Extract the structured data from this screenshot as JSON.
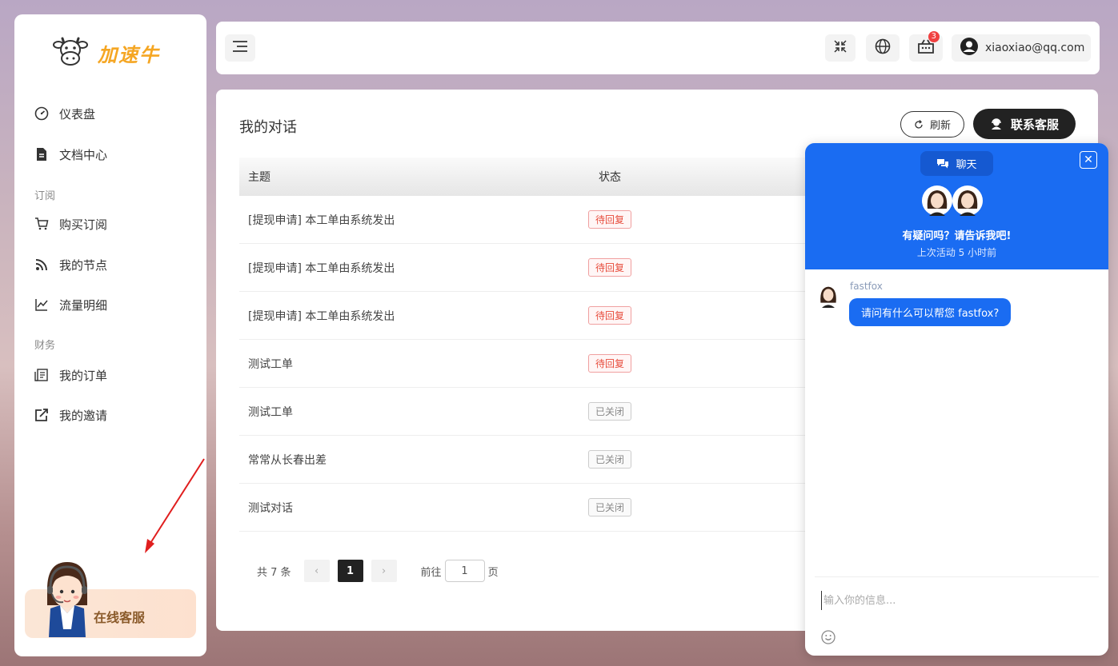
{
  "brand": {
    "name": "加速牛"
  },
  "sidebar": {
    "items": [
      {
        "label": "仪表盘",
        "icon": "dashboard-icon"
      },
      {
        "label": "文档中心",
        "icon": "document-icon"
      },
      {
        "label": "购买订阅",
        "icon": "cart-icon"
      },
      {
        "label": "我的节点",
        "icon": "rss-icon"
      },
      {
        "label": "流量明细",
        "icon": "chart-line-icon"
      },
      {
        "label": "我的订单",
        "icon": "order-icon"
      },
      {
        "label": "我的邀请",
        "icon": "share-icon"
      }
    ],
    "groups": [
      "订阅",
      "财务"
    ],
    "support_label": "在线客服"
  },
  "topbar": {
    "cart_badge": "3",
    "user_email": "xiaoxiao@qq.com"
  },
  "main": {
    "title": "我的对话",
    "refresh_label": "刷新",
    "contact_label": "联系客服",
    "columns": [
      "主题",
      "状态"
    ],
    "rows": [
      {
        "subject": "[提现申请] 本工单由系统发出",
        "status": "待回复",
        "state": "pending"
      },
      {
        "subject": "[提现申请] 本工单由系统发出",
        "status": "待回复",
        "state": "pending"
      },
      {
        "subject": "[提现申请] 本工单由系统发出",
        "status": "待回复",
        "state": "pending"
      },
      {
        "subject": "测试工单",
        "status": "待回复",
        "state": "pending"
      },
      {
        "subject": "测试工单",
        "status": "已关闭",
        "state": "closed"
      },
      {
        "subject": "常常从长春出差",
        "status": "已关闭",
        "state": "closed"
      },
      {
        "subject": "测试对话",
        "status": "已关闭",
        "state": "closed"
      }
    ],
    "pager": {
      "total": "共 7 条",
      "current": "1",
      "goto_prefix": "前往",
      "goto_value": "1",
      "goto_suffix": "页"
    }
  },
  "chat": {
    "tab_label": "聊天",
    "question": "有疑问吗？请告诉我吧!",
    "last_active": "上次活动 5 小时前",
    "sender": "fastfox",
    "message": "请问有什么可以帮您 fastfox?",
    "input_placeholder": "输入你的信息..."
  },
  "colors": {
    "accent": "#1a6cf2",
    "brand": "#f5a623",
    "dark": "#222222",
    "pending": "#e74c3c"
  }
}
